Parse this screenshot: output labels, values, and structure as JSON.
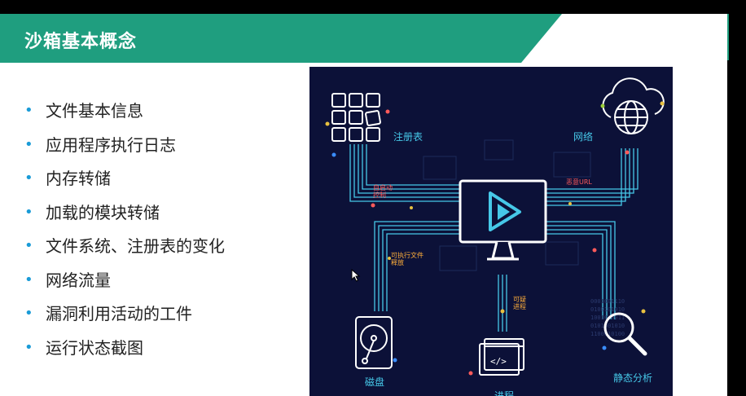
{
  "slide": {
    "title": "沙箱基本概念",
    "bullets": [
      "文件基本信息",
      "应用程序执行日志",
      "内存转储",
      "加载的模块转储",
      "文件系统、注册表的变化",
      "网络流量",
      "漏洞利用活动的工件",
      "运行状态截图"
    ]
  },
  "illustration": {
    "registry_label": "注册表",
    "network_label": "网络",
    "disk_label": "磁盘",
    "process_label": "进程",
    "static_label": "静态分析",
    "autostart_label": "自启动\n控制",
    "malicious_url_label": "恶意URL",
    "exec_release_label": "可执行文件\n释放",
    "suspicious_process_label": "可疑\n进程"
  },
  "colors": {
    "banner": "#1f9e7f",
    "illustration_bg": "#0c1138",
    "line_cyan": "#46c8e8",
    "bullet_dot": "#1a9bd7"
  },
  "icons": [
    "grid-icon",
    "cloud-globe-icon",
    "monitor-play-icon",
    "hard-disk-icon",
    "code-window-icon",
    "magnifier-icon",
    "mouse-cursor-icon"
  ]
}
